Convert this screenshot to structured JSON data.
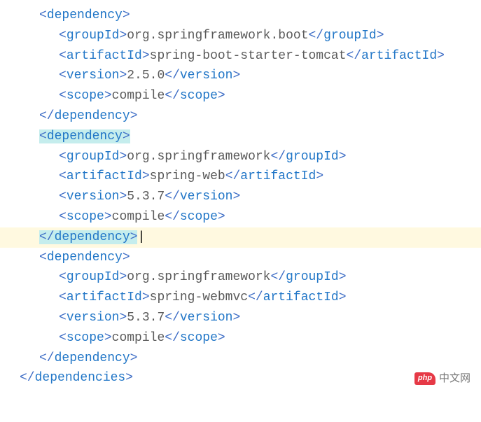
{
  "dependencies": [
    {
      "groupId": "org.springframework.boot",
      "artifactId": "spring-boot-starter-tomcat",
      "version": "2.5.0",
      "scope": "compile",
      "highlighted": false
    },
    {
      "groupId": "org.springframework",
      "artifactId": "spring-web",
      "version": "5.3.7",
      "scope": "compile",
      "highlighted": true
    },
    {
      "groupId": "org.springframework",
      "artifactId": "spring-webmvc",
      "version": "5.3.7",
      "scope": "compile",
      "highlighted": false
    }
  ],
  "tags": {
    "dependency_open": "dependency",
    "dependency_close": "dependency",
    "dependencies_close": "dependencies",
    "groupId": "groupId",
    "artifactId": "artifactId",
    "version": "version",
    "scope": "scope"
  },
  "watermark": {
    "logo": "php",
    "text": "中文网"
  }
}
